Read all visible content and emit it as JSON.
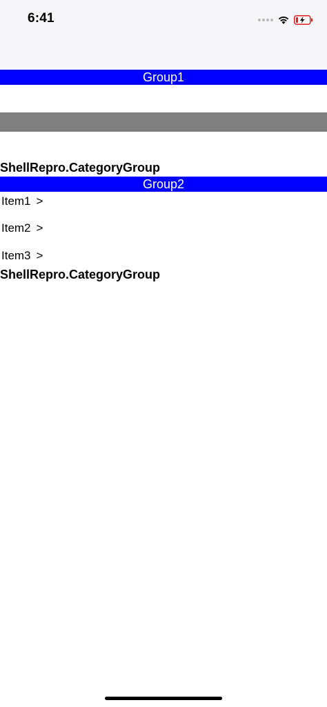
{
  "status_bar": {
    "time": "6:41",
    "icons": [
      "cellular-dots-icon",
      "wifi-icon",
      "battery-charging-icon"
    ],
    "battery_color": "#e02020"
  },
  "group1": {
    "title": "Group1"
  },
  "category1": {
    "label": "ShellRepro.CategoryGroup"
  },
  "group2": {
    "title": "Group2",
    "items": [
      {
        "label": "Item1",
        "chevron": ">"
      },
      {
        "label": "Item2",
        "chevron": ">"
      },
      {
        "label": "Item3",
        "chevron": ">"
      }
    ]
  },
  "category2": {
    "label": "ShellRepro.CategoryGroup"
  },
  "colors": {
    "header_blue": "#0000ff",
    "separator_gray": "#808080",
    "status_bar_bg": "#f6f5f7"
  }
}
